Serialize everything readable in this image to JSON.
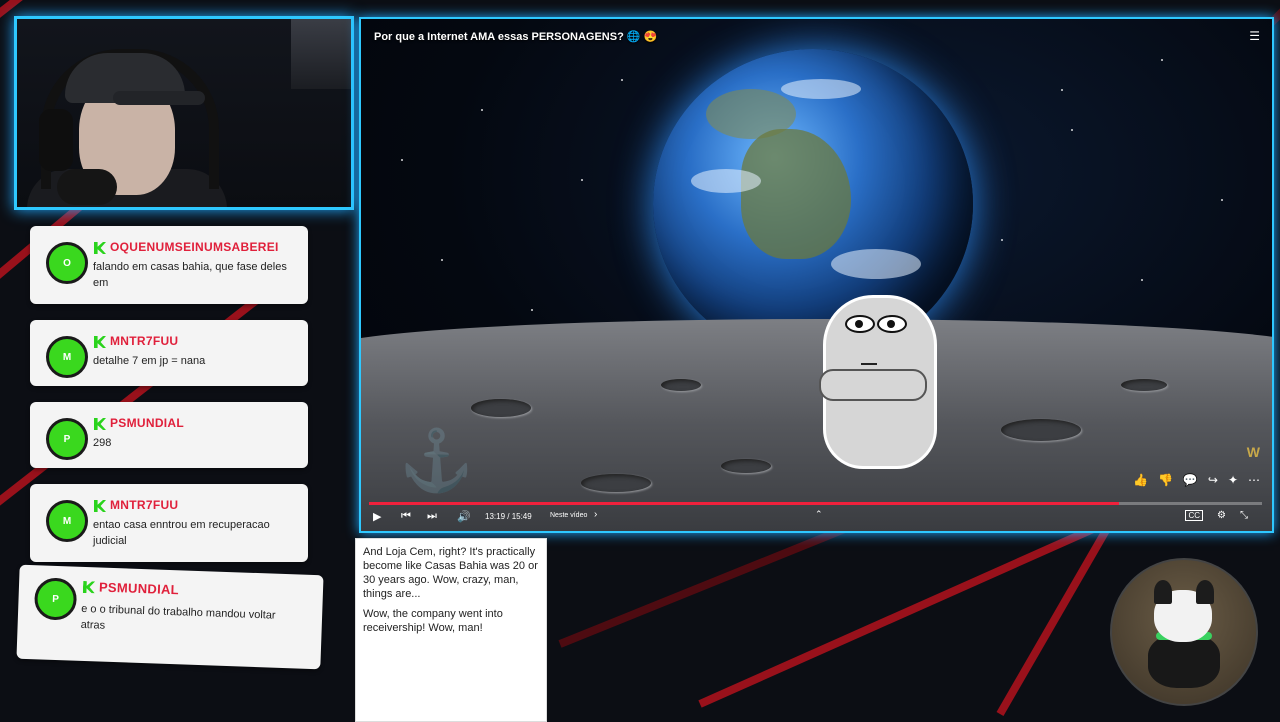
{
  "video": {
    "title": "Por que a Internet AMA essas PERSONAGENS? 🌐 😍",
    "menu_icon": "list-icon",
    "time": "13:19 / 15:49",
    "chapter": "Neste vídeo",
    "progress": 0.84,
    "icons": {
      "play": "▶",
      "prev": "⏮",
      "next": "⏭",
      "volume": "🔊",
      "chapter_chevron": "›",
      "expand": "⌃",
      "like": "👍",
      "dislike": "👎",
      "comment": "💬",
      "share": "↪",
      "remix": "✦",
      "more": "⋯",
      "captions": "CC",
      "settings": "⚙",
      "fullscreen": "⤡"
    },
    "accent_color": "#f0213c"
  },
  "chat": [
    {
      "user": "OQUENUMSEINUMSABEREI",
      "avatar": "O",
      "text": "falando em casas bahia, que fase deles em"
    },
    {
      "user": "MNTR7FUU",
      "avatar": "M",
      "text": "detalhe 7 em jp = nana"
    },
    {
      "user": "PSMUNDIAL",
      "avatar": "P",
      "text": "298"
    },
    {
      "user": "MNTR7FUU",
      "avatar": "M",
      "text": "entao casa enntrou em recuperacao judicial"
    },
    {
      "user": "PSMUNDIAL",
      "avatar": "P",
      "text": "e o o tribunal do trabalho mandou voltar atras"
    }
  ],
  "captions": [
    "And Loja Cem, right? It's practically become like Casas Bahia was 20 or 30 years ago. Wow, crazy, man, things are...",
    "Wow, the company went into receivership! Wow, man!"
  ],
  "theme": {
    "frame_color": "#2ec8ff",
    "stripe_color": "#b3121c",
    "username_color": "#e0203b",
    "badge_color": "#2ad31c"
  }
}
